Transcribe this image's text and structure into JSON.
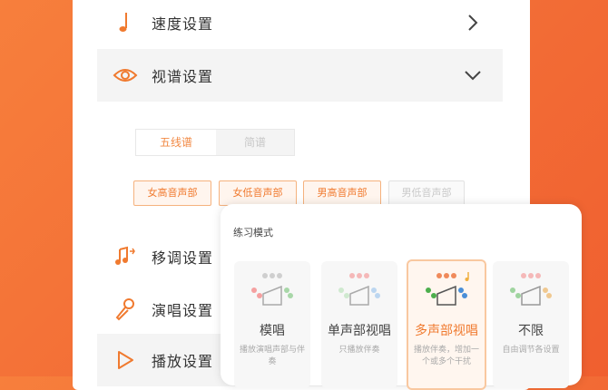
{
  "settings": {
    "speed_label": "速度设置",
    "sight_label": "视谱设置",
    "transpose_label": "移调设置",
    "sing_label": "演唱设置",
    "play_label": "播放设置"
  },
  "notation_toggle": {
    "options": [
      "五线谱",
      "简谱"
    ]
  },
  "voice_parts": [
    "女高音声部",
    "女低音声部",
    "男高音声部",
    "男低音声部"
  ],
  "practice_mode": {
    "title": "练习模式",
    "modes": [
      {
        "name": "模唱",
        "desc": "播放演唱声部与伴奏"
      },
      {
        "name": "单声部视唱",
        "desc": "只播放伴奏"
      },
      {
        "name": "多声部视唱",
        "desc": "播放伴奏，增加一个或多个干扰"
      },
      {
        "name": "不限",
        "desc": "自由调节各设置"
      }
    ]
  },
  "colors": {
    "accent": "#f07a2f",
    "background_gradient": "#f26b35"
  }
}
